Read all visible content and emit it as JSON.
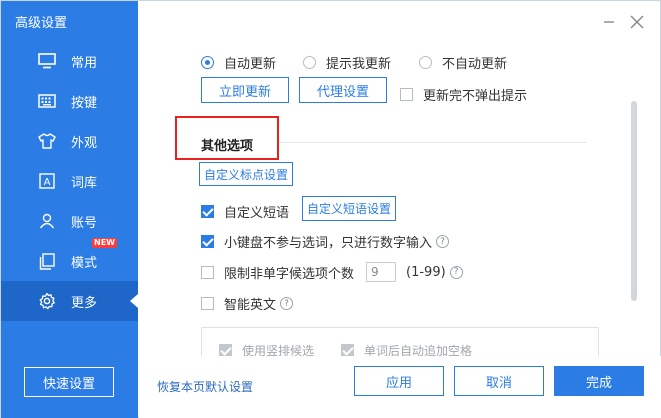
{
  "window": {
    "title": "高级设置"
  },
  "sidebar": {
    "items": [
      {
        "label": "常用",
        "icon": "monitor-icon"
      },
      {
        "label": "按键",
        "icon": "keyboard-icon"
      },
      {
        "label": "外观",
        "icon": "tshirt-icon"
      },
      {
        "label": "词库",
        "icon": "dictionary-icon"
      },
      {
        "label": "账号",
        "icon": "user-icon"
      },
      {
        "label": "模式",
        "icon": "copy-mode-icon",
        "badge": "NEW"
      },
      {
        "label": "更多",
        "icon": "gear-icon",
        "active": true
      }
    ],
    "quick_settings_label": "快速设置"
  },
  "update": {
    "options": [
      "自动更新",
      "提示我更新",
      "不自动更新"
    ],
    "selected": "自动更新",
    "update_now_label": "立即更新",
    "proxy_label": "代理设置",
    "no_popup_label": "更新完不弹出提示"
  },
  "other": {
    "title": "其他选项",
    "custom_punct_label": "自定义标点设置",
    "custom_phrase_label": "自定义短语",
    "custom_phrase_settings_label": "自定义短语设置",
    "keypad_label": "小键盘不参与选词，只进行数字输入",
    "limit_label": "限制非单字候选项个数",
    "limit_value": "9",
    "limit_range": "(1-99)",
    "smart_english_label": "智能英文",
    "sub_options": [
      "使用竖排候选",
      "单词后自动追加空格"
    ]
  },
  "footer": {
    "reset_label": "恢复本页默认设置",
    "apply_label": "应用",
    "cancel_label": "取消",
    "done_label": "完成"
  },
  "colors": {
    "accent": "#2b7de5",
    "sidebar_active": "#1e67c9",
    "highlight": "#e8231f"
  }
}
